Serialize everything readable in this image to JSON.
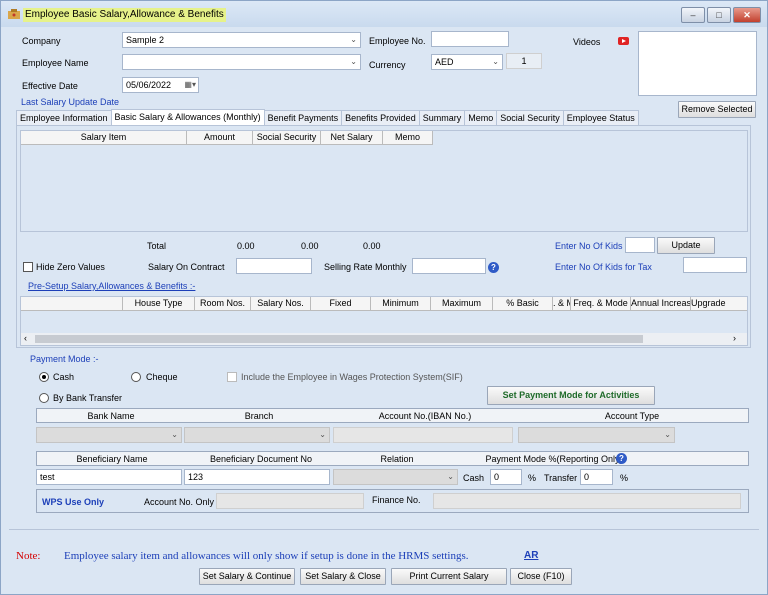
{
  "window": {
    "title": "Employee Basic Salary,Allowance & Benefits",
    "minimize": "–",
    "maximize": "□",
    "close": "✕"
  },
  "header": {
    "company_label": "Company",
    "company_value": "Sample 2",
    "employee_no_label": "Employee No.",
    "employee_no_value": "",
    "videos_label": "Videos",
    "employee_name_label": "Employee Name",
    "employee_name_value": "",
    "currency_label": "Currency",
    "currency_value": "AED",
    "currency_rate": "1",
    "effective_date_label": "Effective Date",
    "effective_date_value": "05/06/2022",
    "last_salary_update_label": "Last Salary Update Date",
    "remove_selected": "Remove Selected"
  },
  "tabs": [
    "Employee Information",
    "Basic Salary & Allowances (Monthly)",
    "Benefit Payments",
    "Benefits Provided",
    "Summary",
    "Memo",
    "Social Security",
    "Employee Status"
  ],
  "salary_grid": {
    "columns": [
      "Salary Item",
      "Amount",
      "Social Security",
      "Net Salary",
      "Memo"
    ]
  },
  "totals": {
    "total_label": "Total",
    "amount": "0.00",
    "social_security": "0.00",
    "net_salary": "0.00",
    "enter_no_kids": "Enter No Of Kids",
    "update": "Update",
    "hide_zero": "Hide Zero Values",
    "salary_on_contract": "Salary On Contract",
    "selling_rate": "Selling Rate Monthly",
    "enter_no_kids_tax": "Enter No Of Kids for Tax"
  },
  "presetup": {
    "link": "Pre-Setup Salary,Allowances & Benefits :-",
    "columns": [
      "House Type",
      "Room Nos.",
      "Salary Nos.",
      "Fixed",
      "Minimum",
      "Maximum",
      "% Basic",
      ". & M",
      "Freq. & Mode",
      "Annual Increas",
      "Upgrade Ye"
    ]
  },
  "payment": {
    "mode_label": "Payment Mode :-",
    "cash": "Cash",
    "cheque": "Cheque",
    "bank_transfer": "By Bank Transfer",
    "wps_include": "Include the Employee in Wages Protection System(SIF)",
    "set_mode_button": "Set Payment Mode for Activities",
    "bank_cols": [
      "Bank Name",
      "Branch",
      "Account No.(IBAN No.)",
      "Account Type"
    ],
    "bene_cols": [
      "Beneficiary Name",
      "Beneficiary Document No",
      "Relation",
      "Payment Mode %(Reporting Only)"
    ],
    "beneficiary_name": "test",
    "beneficiary_doc": "123",
    "cash_label": "Cash",
    "cash_value": "0",
    "pct": "%",
    "transfer_label": "Transfer",
    "transfer_value": "0",
    "wps_only": "WPS Use Only",
    "account_no_only": "Account No. Only",
    "finance_no": "Finance No."
  },
  "footer": {
    "note_label": "Note:",
    "note_text": "Employee salary item and allowances will only show if setup is done in the HRMS settings.",
    "ar": "AR",
    "buttons": [
      "Set Salary & Continue",
      "Set Salary & Close",
      "Print Current Salary",
      "Close  (F10)"
    ]
  },
  "colors": {
    "accent_blue": "#1c3fb8",
    "note_red": "#d40000",
    "wps_green": "#1f6b2a"
  },
  "icons": {
    "youtube": "youtube-icon",
    "calendar": "calendar-icon",
    "help": "help-icon"
  }
}
